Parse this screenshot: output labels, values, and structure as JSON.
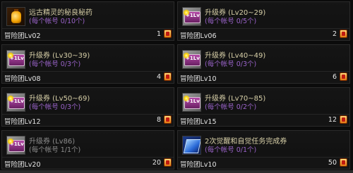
{
  "items": [
    {
      "title": "远古精灵的秘良秘药",
      "sub": "(每个帐号 0/10个)",
      "group": "冒险团Lv02",
      "price": "1",
      "icon": "potion-icon",
      "dim": false
    },
    {
      "title": "升级券 (Lv20~29)",
      "sub": "(每个帐号 0/5个)",
      "group": "冒险团Lv06",
      "price": "2",
      "icon": "level-ticket-icon",
      "dim": false
    },
    {
      "title": "升级券 (Lv30~39)",
      "sub": "(每个帐号 0/3个)",
      "group": "冒险团Lv08",
      "price": "4",
      "icon": "level-ticket-icon",
      "dim": false
    },
    {
      "title": "升级券 (Lv40~49)",
      "sub": "(每个帐号 0/3个)",
      "group": "冒险团Lv10",
      "price": "6",
      "icon": "level-ticket-icon",
      "dim": false
    },
    {
      "title": "升级券 (Lv50~69)",
      "sub": "(每个帐号 0/3个)",
      "group": "冒险团Lv12",
      "price": "8",
      "icon": "level-ticket-icon",
      "dim": false
    },
    {
      "title": "升级券 (Lv70~85)",
      "sub": "(每个帐号 0/2个)",
      "group": "冒险团Lv15",
      "price": "12",
      "icon": "level-ticket-icon",
      "dim": false
    },
    {
      "title": "升级券 (Lv86)",
      "sub": "(每个帐号 1/1个)",
      "group": "冒险团Lv20",
      "price": "20",
      "icon": "level-ticket-icon",
      "dim": true
    },
    {
      "title": "2次觉醒和自觉任务完成券",
      "sub": "(每个帐号 0/1个)",
      "group": "冒险团Lv10",
      "price": "50",
      "icon": "awakening-ticket-icon",
      "dim": false
    }
  ],
  "ticket_label": "+1Lv",
  "colors": {
    "title": "#d8d0a8",
    "sub": "#9a63c9",
    "dim": "#8c8c8c",
    "text": "#e6e6e6"
  }
}
